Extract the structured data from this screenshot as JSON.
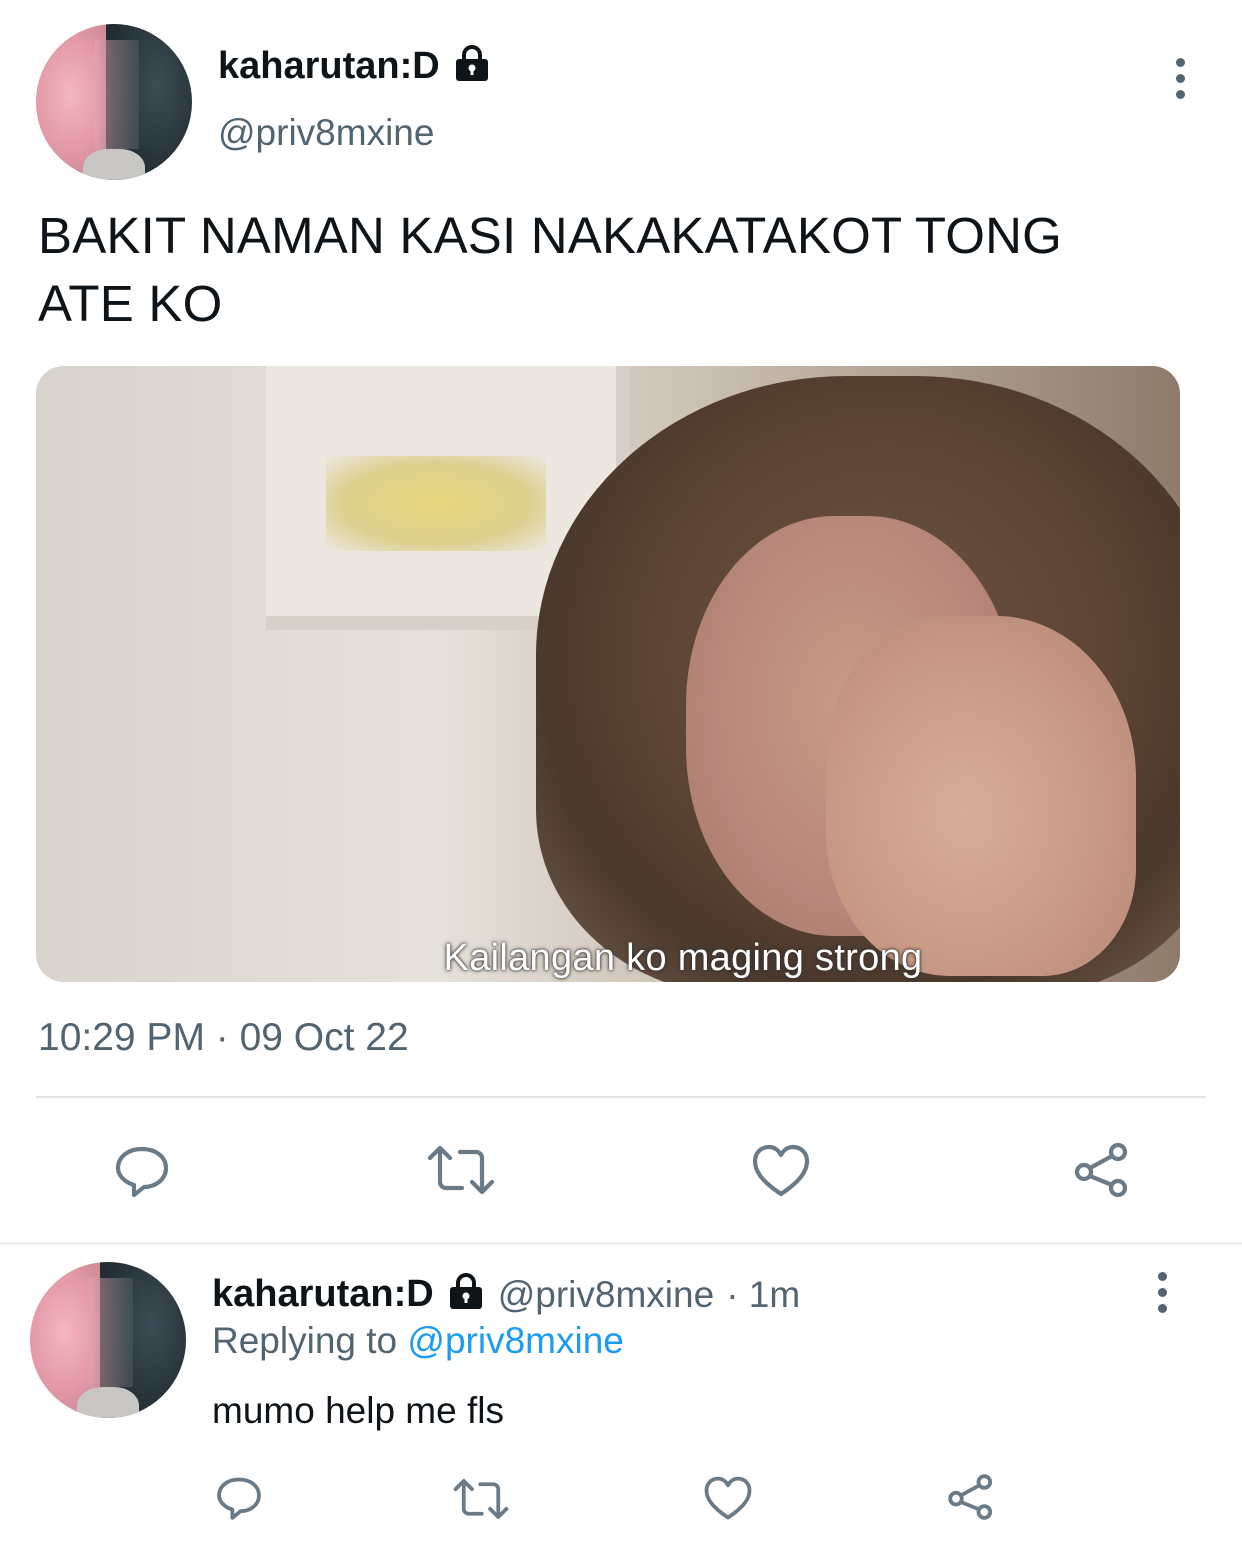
{
  "main_tweet": {
    "display_name": "kaharutan:D",
    "handle": "@priv8mxine",
    "text_line1": "BAKIT NAMAN KASI NAKAKATAKOT TONG",
    "text_line2": "ATE KO",
    "media_caption": "Kailangan ko maging strong",
    "timestamp": "10:29 PM · 09 Oct 22"
  },
  "reply_tweet": {
    "display_name": "kaharutan:D",
    "handle": "@priv8mxine",
    "age": "· 1m",
    "replying_prefix": "Replying to",
    "replying_handle": "@priv8mxine",
    "text": "mumo help me fls"
  },
  "icons": {
    "reply": "reply-icon",
    "retweet": "retweet-icon",
    "like": "heart-icon",
    "share": "share-icon",
    "lock": "lock-icon",
    "more": "more-icon"
  },
  "colors": {
    "text": "#0f1419",
    "muted": "#536471",
    "link": "#1d9bf0",
    "divider": "#e1e6ea"
  }
}
